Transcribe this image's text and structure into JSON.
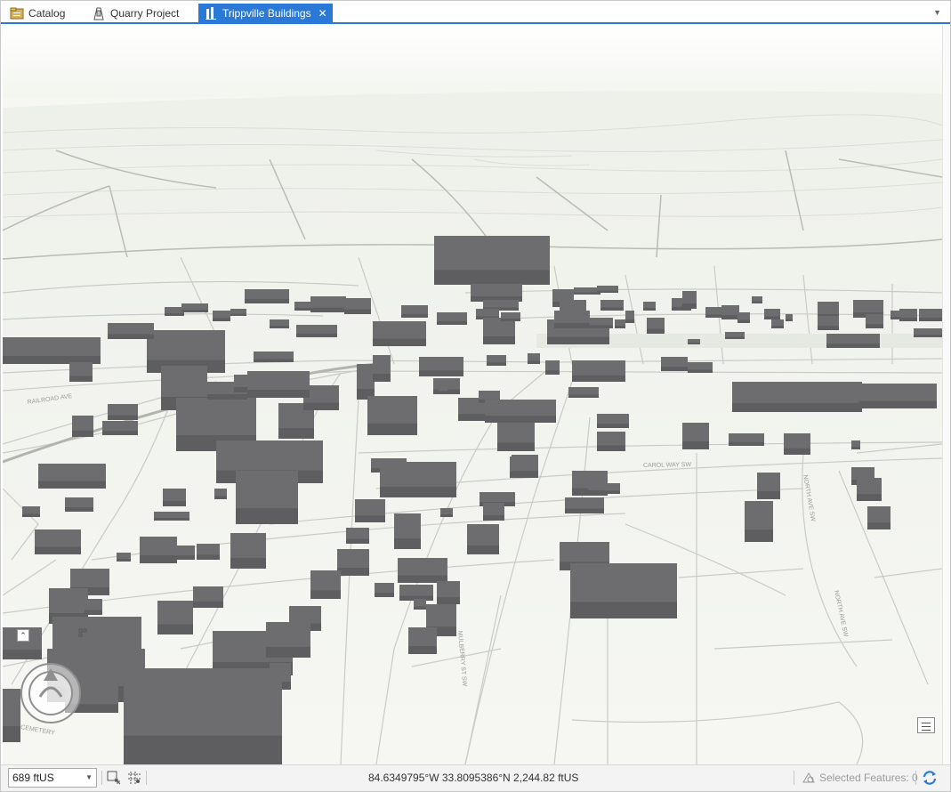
{
  "tabs": [
    {
      "label": "Catalog",
      "icon": "catalog-icon",
      "active": false
    },
    {
      "label": "Quarry Project",
      "icon": "layout-icon",
      "active": false
    },
    {
      "label": "Trippville Buildings",
      "icon": "scene-icon",
      "active": true
    }
  ],
  "tabs_overflow_icon": "chevron-down-icon",
  "map": {
    "street_labels": [
      "CAROL WAY SW",
      "NORTH AVE SW",
      "RAILROAD AVE",
      "NORTH AVE SW",
      "CEMETERY",
      "MULBERRY ST SW"
    ],
    "colors": {
      "building": "#6d6d6f",
      "building_shade": "#5e5e60",
      "ground": "#f6f7f3",
      "roads": "#c9cbc6"
    }
  },
  "status": {
    "scale": "689 ftUS",
    "coordinates": "84.6349795°W 33.8095386°N  2,244.82 ftUS",
    "selected_features": "Selected Features: 0"
  }
}
